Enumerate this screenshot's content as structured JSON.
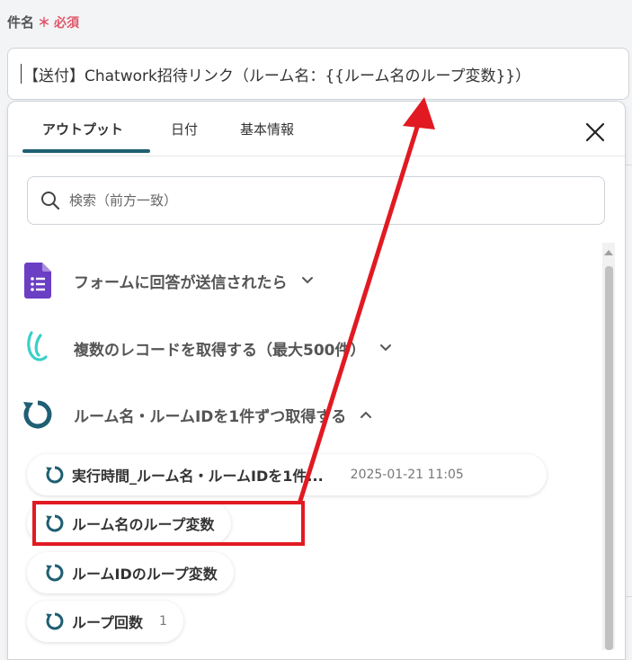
{
  "field": {
    "label": "件名",
    "required_mark": "＊",
    "required_text": "必須",
    "value": "【送付】Chatwork招待リンク（ルーム名：{{ルーム名のループ変数}}）"
  },
  "tabs": [
    {
      "label": "アウトプット"
    },
    {
      "label": "日付"
    },
    {
      "label": "基本情報"
    }
  ],
  "search": {
    "placeholder": "検索（前方一致）"
  },
  "sections": [
    {
      "label": "フォームに回答が送信されたら",
      "icon": "google-forms-icon",
      "expanded": false
    },
    {
      "label": "複数のレコードを取得する（最大500件）",
      "icon": "kintone-icon",
      "expanded": false
    },
    {
      "label": "ルーム名・ルームIDを1件ずつ取得する",
      "icon": "loop-icon",
      "expanded": true
    }
  ],
  "items": [
    {
      "label": "実行時間_ルーム名・ルームIDを1件...",
      "meta": "2025-01-21 11:05"
    },
    {
      "label": "ルーム名のループ変数"
    },
    {
      "label": "ルームIDのループ変数"
    },
    {
      "label": "ループ回数",
      "count": "1"
    }
  ],
  "colors": {
    "accent": "#1f5f73",
    "required": "#e0566b",
    "highlight": "#e11a22",
    "forms_purple": "#6b3fc4",
    "kintone_teal": "#3ad0c8"
  }
}
